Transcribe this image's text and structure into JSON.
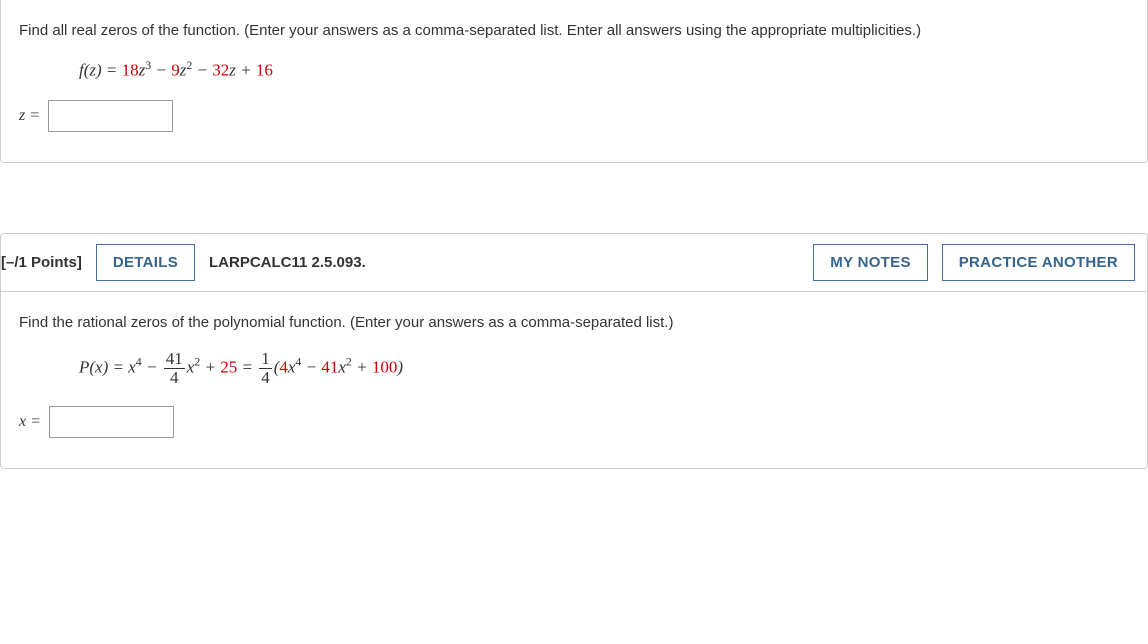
{
  "q1": {
    "prompt": "Find all real zeros of the function. (Enter your answers as a comma-separated list. Enter all answers using the appropriate multiplicities.)",
    "func_lhs": "f(z) = ",
    "c1": "18",
    "v1": "z",
    "e1": "3",
    "op1": " − ",
    "c2": "9",
    "v2": "z",
    "e2": "2",
    "op2": " − ",
    "c3": "32",
    "v3": "z",
    "op3": " + ",
    "c4": "16",
    "answer_label": "z ="
  },
  "header": {
    "points": "[–/1 Points]",
    "details": "DETAILS",
    "ref": "LARPCALC11 2.5.093.",
    "mynotes": "MY NOTES",
    "practice": "PRACTICE ANOTHER"
  },
  "q2": {
    "prompt": "Find the rational zeros of the polynomial function. (Enter your answers as a comma-separated list.)",
    "lhs": "P(x) = x",
    "lhs_exp": "4",
    "minus": " − ",
    "f1num": "41",
    "f1den": "4",
    "mid_v": "x",
    "mid_e": "2",
    "plus": " + ",
    "c25": "25",
    "eq": " = ",
    "f2num": "1",
    "f2den": "4",
    "paren_open": "(",
    "p_c1": "4",
    "p_v1": "x",
    "p_e1": "4",
    "p_op1": " − ",
    "p_c2": "41",
    "p_v2": "x",
    "p_e2": "2",
    "p_op2": " + ",
    "p_c3": "100",
    "paren_close": ")",
    "answer_label": "x ="
  }
}
